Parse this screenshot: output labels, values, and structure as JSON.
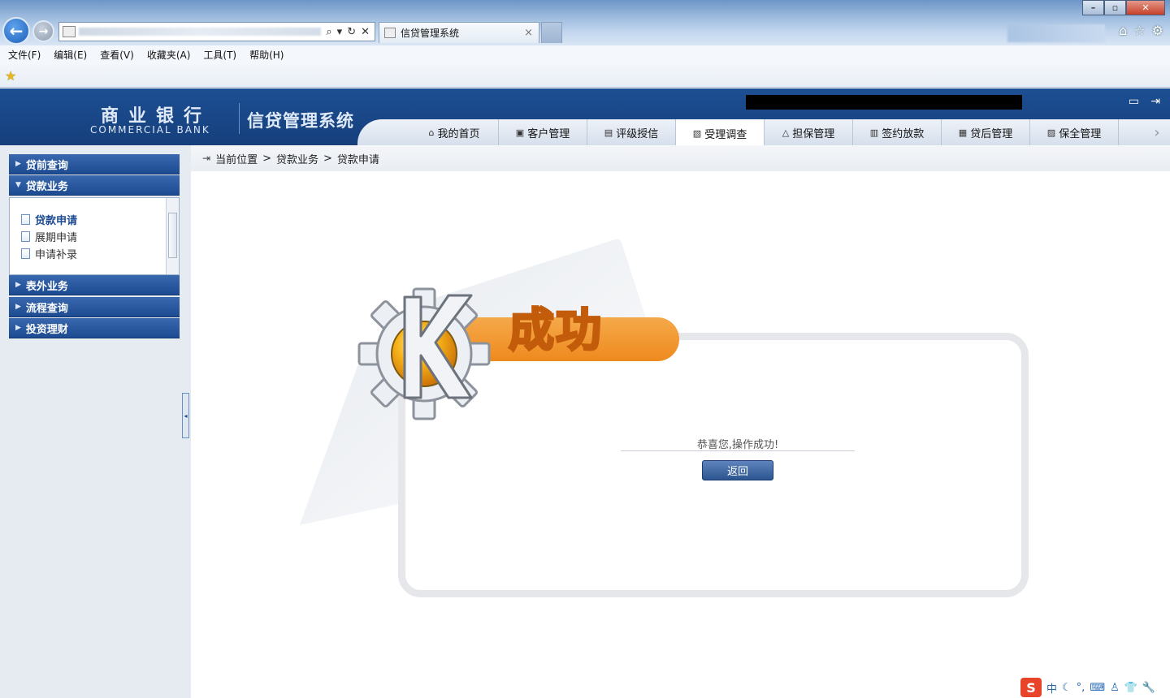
{
  "browser": {
    "tab_title": "信贷管理系统",
    "tab_close": "×",
    "back": "←",
    "forward": "→",
    "addr_tools": [
      "⌕",
      "▾",
      "↻",
      "✕"
    ],
    "win_min": "–",
    "win_max": "▫",
    "win_close": "✕",
    "chrome_icons": [
      "⌂",
      "☆",
      "⚙"
    ],
    "menu": [
      "文件(F)",
      "编辑(E)",
      "查看(V)",
      "收藏夹(A)",
      "工具(T)",
      "帮助(H)"
    ]
  },
  "header": {
    "brand_cn": "商业银行",
    "brand_en": "COMMERCIAL BANK",
    "system_title": "信贷管理系统",
    "nav_tabs": [
      {
        "label": "我的首页",
        "icon": "⌂"
      },
      {
        "label": "客户管理",
        "icon": "▣"
      },
      {
        "label": "评级授信",
        "icon": "▤"
      },
      {
        "label": "受理调查",
        "icon": "▧"
      },
      {
        "label": "担保管理",
        "icon": "△"
      },
      {
        "label": "签约放款",
        "icon": "▥"
      },
      {
        "label": "贷后管理",
        "icon": "▦"
      },
      {
        "label": "保全管理",
        "icon": "▨"
      }
    ],
    "active_tab": "受理调查",
    "nav_more": "›"
  },
  "sidebar": {
    "groups": [
      {
        "label": "贷前查询",
        "expanded": false
      },
      {
        "label": "贷款业务",
        "expanded": true
      },
      {
        "label": "表外业务",
        "expanded": false
      },
      {
        "label": "流程查询",
        "expanded": false
      },
      {
        "label": "投资理财",
        "expanded": false
      }
    ],
    "items": [
      {
        "label": "贷款申请",
        "current": true
      },
      {
        "label": "展期申请",
        "current": false
      },
      {
        "label": "申请补录",
        "current": false
      }
    ],
    "collapse_glyph": "◂"
  },
  "breadcrumb": {
    "icon": "⇥",
    "parts": [
      "当前位置",
      ">",
      "贷款业务",
      ">",
      "贷款申请"
    ]
  },
  "result": {
    "banner": "成功",
    "message": "恭喜您,操作成功!",
    "return_label": "返回"
  },
  "tray": {
    "items": [
      "S",
      "中",
      "☾",
      "°,",
      "⌨",
      "♙",
      "👕",
      "🔧"
    ]
  },
  "colors": {
    "brand_blue": "#1c4f93",
    "accent_orange": "#ee8a1e"
  }
}
